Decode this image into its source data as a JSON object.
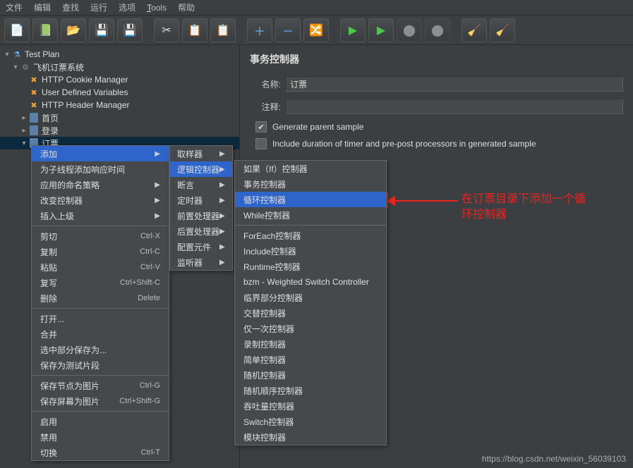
{
  "menu": {
    "file": "文件",
    "edit": "编辑",
    "search": "查找",
    "run": "运行",
    "options": "选项",
    "tools": "Tools",
    "help": "帮助"
  },
  "tree": {
    "root": "Test Plan",
    "sys": "飞机订票系统",
    "cookie": "HTTP Cookie Manager",
    "vars": "User Defined Variables",
    "header": "HTTP Header Manager",
    "home": "首页",
    "login": "登录",
    "ticket": "订票"
  },
  "panel": {
    "title": "事务控制器",
    "name_label": "名称:",
    "name_value": "订票",
    "comment_label": "注释:",
    "comment_value": "",
    "chk1": "Generate parent sample",
    "chk2": "Include duration of timer and pre-post processors in generated sample"
  },
  "ctx1": {
    "add": "添加",
    "thread_time": "为子线程添加响应时间",
    "naming": "应用的命名策略",
    "change_ctrl": "改变控制器",
    "insert_parent": "插入上级",
    "cut": "剪切",
    "cut_k": "Ctrl-X",
    "copy": "复制",
    "copy_k": "Ctrl-C",
    "paste": "粘贴",
    "paste_k": "Ctrl-V",
    "dup": "复写",
    "dup_k": "Ctrl+Shift-C",
    "del": "删除",
    "del_k": "Delete",
    "open": "打开...",
    "merge": "合并",
    "save_sel": "选中部分保存为...",
    "save_frag": "保存为测试片段",
    "save_node_img": "保存节点为图片",
    "save_node_img_k": "Ctrl-G",
    "save_screen_img": "保存屏幕为图片",
    "save_screen_img_k": "Ctrl+Shift-G",
    "enable": "启用",
    "disable": "禁用",
    "toggle": "切换",
    "toggle_k": "Ctrl-T"
  },
  "ctx2": {
    "sampler": "取样器",
    "logic": "逻辑控制器",
    "assert": "断言",
    "timer": "定时器",
    "pre": "前置处理器",
    "post": "后置处理器",
    "config": "配置元件",
    "listener": "监听器"
  },
  "ctx3": {
    "if": "如果（If）控制器",
    "trans": "事务控制器",
    "loop": "循环控制器",
    "while": "While控制器",
    "foreach": "ForEach控制器",
    "include": "Include控制器",
    "runtime": "Runtime控制器",
    "bzm": "bzm - Weighted Switch Controller",
    "crit": "临界部分控制器",
    "interleave": "交替控制器",
    "once": "仅一次控制器",
    "record": "录制控制器",
    "simple": "简单控制器",
    "random": "随机控制器",
    "random_order": "随机顺序控制器",
    "throughput": "吞吐量控制器",
    "switch": "Switch控制器",
    "module": "模块控制器"
  },
  "note": "在订票目录下添加一个循环控制器",
  "watermark": "https://blog.csdn.net/weixin_56039103"
}
